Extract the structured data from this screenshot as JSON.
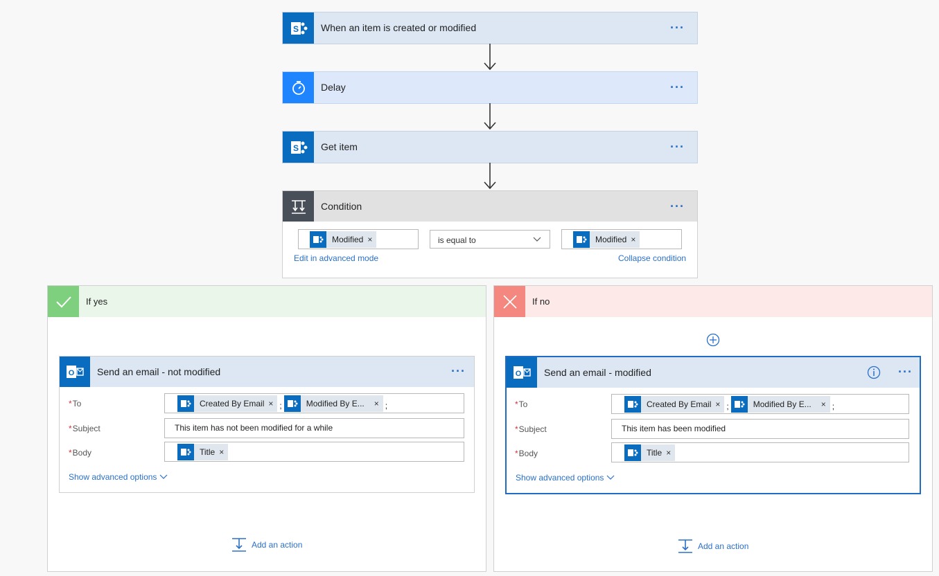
{
  "steps": {
    "trigger": {
      "title": "When an item is created or modified",
      "icon": "sharepoint-icon"
    },
    "delay": {
      "title": "Delay",
      "icon": "timer-icon"
    },
    "get_item": {
      "title": "Get item",
      "icon": "sharepoint-icon"
    },
    "condition": {
      "title": "Condition",
      "icon": "condition-icon",
      "left_token": "Modified",
      "operator": "is equal to",
      "right_token": "Modified",
      "edit_advanced": "Edit in advanced mode",
      "collapse": "Collapse condition"
    }
  },
  "more_label": "···",
  "branches": {
    "yes": {
      "title": "If yes",
      "color": "#7ed07e",
      "card": {
        "title": "Send an email - not modified",
        "to_label": "To",
        "to_tokens": [
          "Created By Email",
          "Modified By E..."
        ],
        "subject_label": "Subject",
        "subject_value": "This item has not been modified for a while",
        "body_label": "Body",
        "body_token": "Title",
        "advanced": "Show advanced options"
      },
      "add_action": "Add an action"
    },
    "no": {
      "title": "If no",
      "color": "#f4877f",
      "card": {
        "title": "Send an email - modified",
        "to_label": "To",
        "to_tokens": [
          "Created By Email",
          "Modified By E..."
        ],
        "subject_label": "Subject",
        "subject_value": "This item has been modified",
        "body_label": "Body",
        "body_token": "Title",
        "advanced": "Show advanced options"
      },
      "add_action": "Add an action"
    }
  },
  "token_separator": ";",
  "colors": {
    "accent": "#2a70c8",
    "sharepoint": "#0a6cbf",
    "delay": "#1f85ff",
    "condition": "#484f58"
  }
}
